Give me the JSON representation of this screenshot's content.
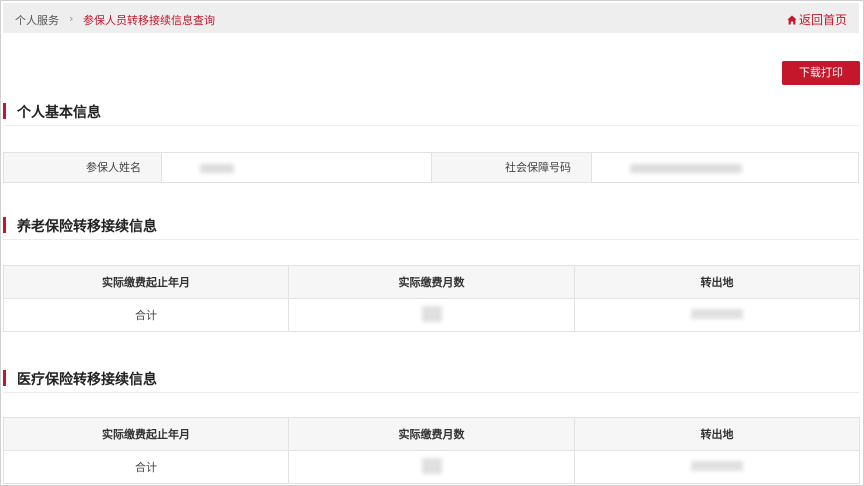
{
  "breadcrumb": {
    "home": "个人服务",
    "separator": "›",
    "current": "参保人员转移接续信息查询",
    "back_label": "返回首页"
  },
  "toolbar": {
    "download_label": "下载打印"
  },
  "basic_info": {
    "title": "个人基本信息",
    "name_label": "参保人姓名",
    "ssn_label": "社会保障号码"
  },
  "pension": {
    "title": "养老保险转移接续信息",
    "headers": [
      "实际缴费起止年月",
      "实际缴费月数",
      "转出地"
    ],
    "total_label": "合计"
  },
  "medical": {
    "title": "医疗保险转移接续信息",
    "headers": [
      "实际缴费起止年月",
      "实际缴费月数",
      "转出地"
    ],
    "total_label": "合计"
  },
  "colors": {
    "accent": "#c4172c",
    "header_bg": "#f6f6f6",
    "topbar_bg": "#eeeeee"
  },
  "icons": {
    "back": "home-icon"
  }
}
